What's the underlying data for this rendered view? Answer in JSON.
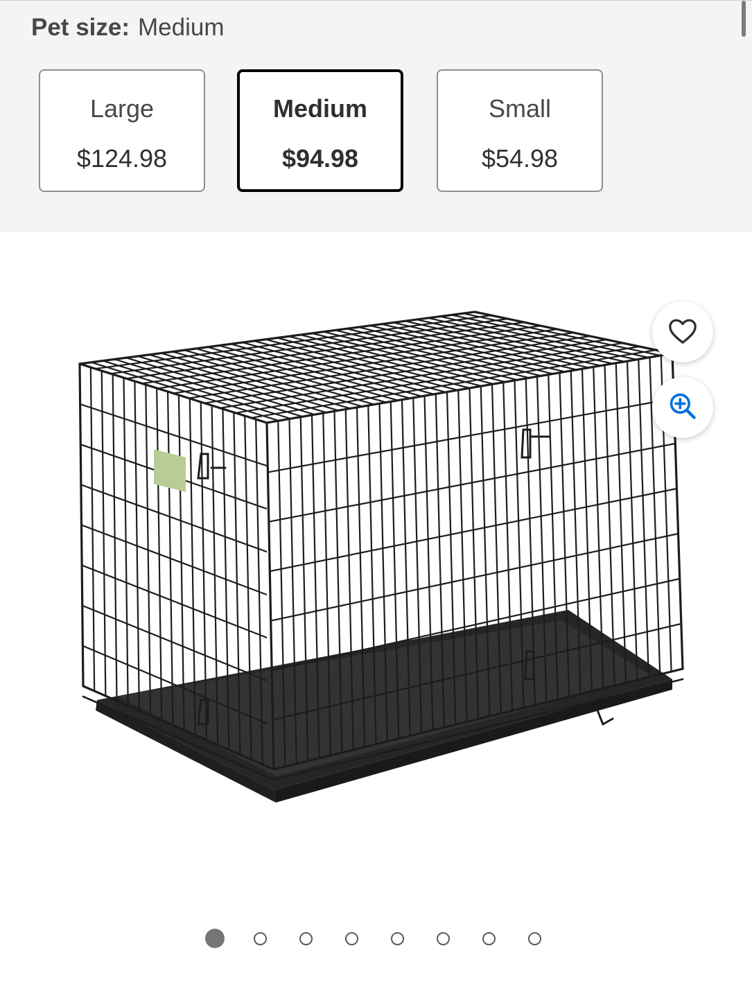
{
  "variant": {
    "label": "Pet size:",
    "selected_value": "Medium",
    "options": [
      {
        "name": "Large",
        "price": "$124.98",
        "selected": false
      },
      {
        "name": "Medium",
        "price": "$94.98",
        "selected": true
      },
      {
        "name": "Small",
        "price": "$54.98",
        "selected": false
      }
    ]
  },
  "media": {
    "image_subject": "black wire dog crate with plastic tray",
    "actions": {
      "favorite_icon": "heart-icon",
      "zoom_icon": "zoom-in-icon",
      "accent_color": "#0071dc"
    },
    "carousel": {
      "total": 8,
      "active_index": 0
    }
  },
  "colors": {
    "top_background": "#f4f4f4",
    "selected_border": "#000000",
    "option_border": "#8e8e8e"
  }
}
